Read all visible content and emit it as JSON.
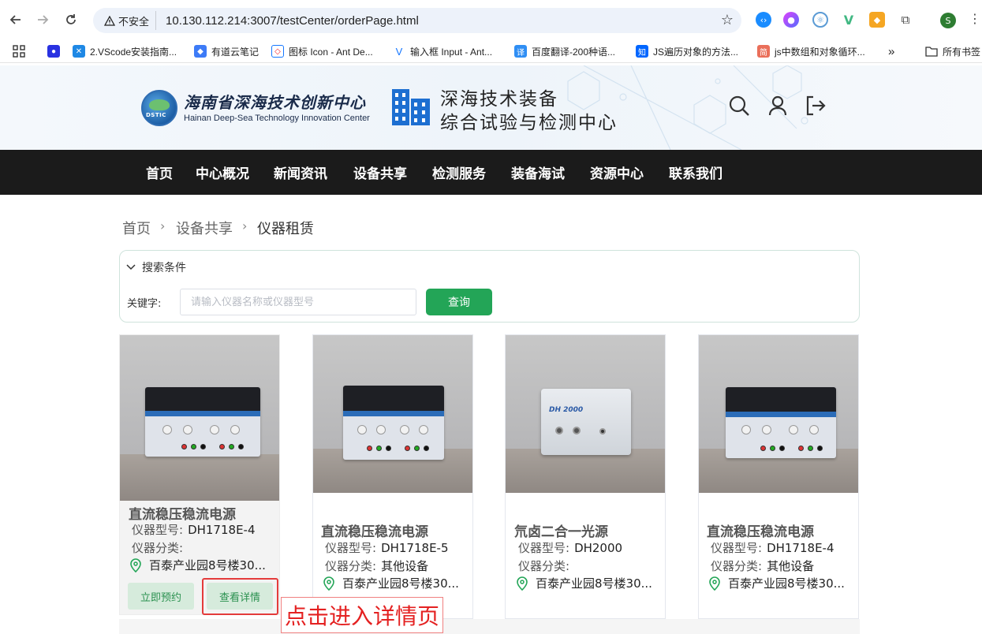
{
  "browser": {
    "insecure_label": "不安全",
    "url": "10.130.112.214:3007/testCenter/orderPage.html",
    "profile_initial": "S",
    "bookmarks": [
      "2.VScode安装指南...",
      "有道云笔记",
      "图标 Icon - Ant De...",
      "输入框 Input - Ant...",
      "百度翻译-200种语...",
      "JS遍历对象的方法...",
      "js中数组和对象循环...",
      "所有书签"
    ],
    "overflow": "»"
  },
  "header": {
    "logo_tag": "DSTIC",
    "org_cn": "海南省深海技术创新中心",
    "org_en": "Hainan Deep-Sea Technology Innovation Center",
    "slogan_line1": "深海技术装备",
    "slogan_line2": "综合试验与检测中心"
  },
  "nav": [
    "首页",
    "中心概况",
    "新闻资讯",
    "设备共享",
    "检测服务",
    "装备海试",
    "资源中心",
    "联系我们"
  ],
  "breadcrumb": [
    "首页",
    "设备共享",
    "仪器租赁"
  ],
  "search": {
    "title": "搜索条件",
    "keyword_label": "关键字:",
    "placeholder": "请输入仪器名称或仪器型号",
    "value": "",
    "button": "查询"
  },
  "cards": [
    {
      "name": "直流稳压稳流电源",
      "model_label": "仪器型号:",
      "model": "DH1718E-4",
      "category_label": "仪器分类:",
      "category": "",
      "location": "百泰产业园8号楼30..."
    },
    {
      "name": "直流稳压稳流电源",
      "model_label": "仪器型号:",
      "model": "DH1718E-5",
      "category_label": "仪器分类:",
      "category": "其他设备",
      "location": "百泰产业园8号楼30..."
    },
    {
      "name": "氘卤二合一光源",
      "model_label": "仪器型号:",
      "model": "DH2000",
      "category_label": "仪器分类:",
      "category": "",
      "location": "百泰产业园8号楼30...",
      "device_label": "DH 2000"
    },
    {
      "name": "直流稳压稳流电源",
      "model_label": "仪器型号:",
      "model": "DH1718E-4",
      "category_label": "仪器分类:",
      "category": "其他设备",
      "location": "百泰产业园8号楼30..."
    }
  ],
  "card_actions": {
    "reserve": "立即预约",
    "detail": "查看详情"
  },
  "annotation": "点击进入详情页",
  "colors": {
    "accent_green": "#23a557",
    "nav_bg": "#1b1b1b",
    "annotation_red": "#e42121"
  }
}
